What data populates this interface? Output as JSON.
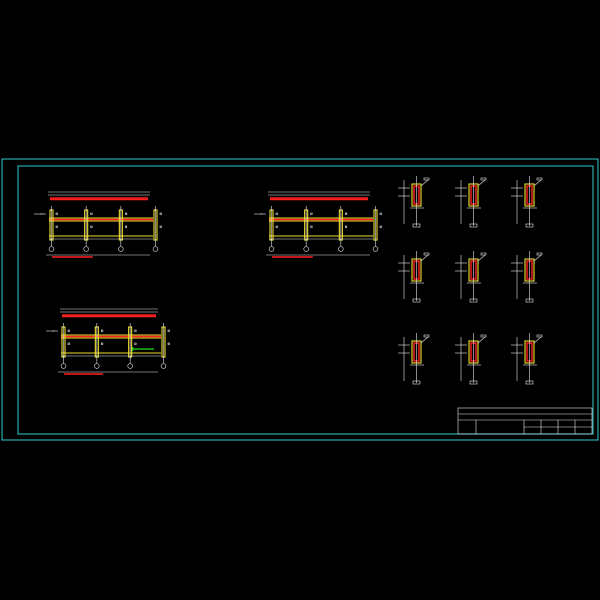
{
  "drawing": {
    "colors": {
      "background": "#000000",
      "frame": "#2fd0d0",
      "linework": "#e8e8e8",
      "rebar": "#ff2020",
      "concrete_outline": "#f0e030",
      "highlight": "#20e020"
    },
    "elevations": [
      {
        "name": "elevation-a"
      },
      {
        "name": "elevation-b"
      },
      {
        "name": "elevation-c"
      }
    ],
    "details": [
      {
        "name": "detail-1"
      },
      {
        "name": "detail-2"
      },
      {
        "name": "detail-3"
      },
      {
        "name": "detail-4"
      },
      {
        "name": "detail-5"
      },
      {
        "name": "detail-6"
      },
      {
        "name": "detail-7"
      },
      {
        "name": "detail-8"
      },
      {
        "name": "detail-9"
      }
    ],
    "title_block": {
      "rows": 3
    }
  }
}
